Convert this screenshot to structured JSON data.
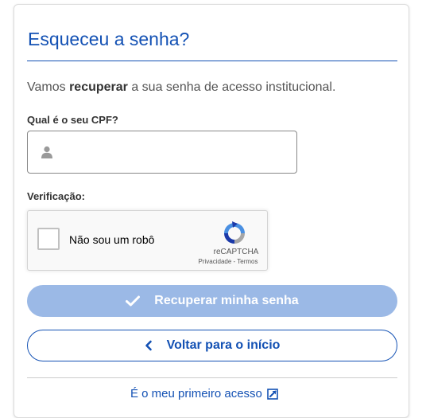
{
  "page": {
    "title": "Esqueceu a senha?",
    "intro_before": "Vamos ",
    "intro_bold": "recuperar",
    "intro_after": " a sua senha de acesso institucional."
  },
  "cpf": {
    "label": "Qual é o seu CPF?",
    "value": "",
    "icon": "user-icon"
  },
  "verification": {
    "label": "Verificação:",
    "captcha_text": "Não sou um robô",
    "captcha_brand": "reCAPTCHA",
    "privacy_link": "Privacidade",
    "separator": " - ",
    "terms_link": "Termos"
  },
  "buttons": {
    "recover_label": "Recuperar minha senha",
    "recover_icon": "check-icon",
    "back_label": "Voltar para o início",
    "back_icon": "chevron-left-icon"
  },
  "first_access": {
    "label": "É o meu primeiro acesso",
    "icon": "external-link-icon"
  },
  "colors": {
    "primary": "#1351b4",
    "primary_disabled": "#9bb9e6",
    "text": "#333333",
    "muted_text": "#555555"
  }
}
